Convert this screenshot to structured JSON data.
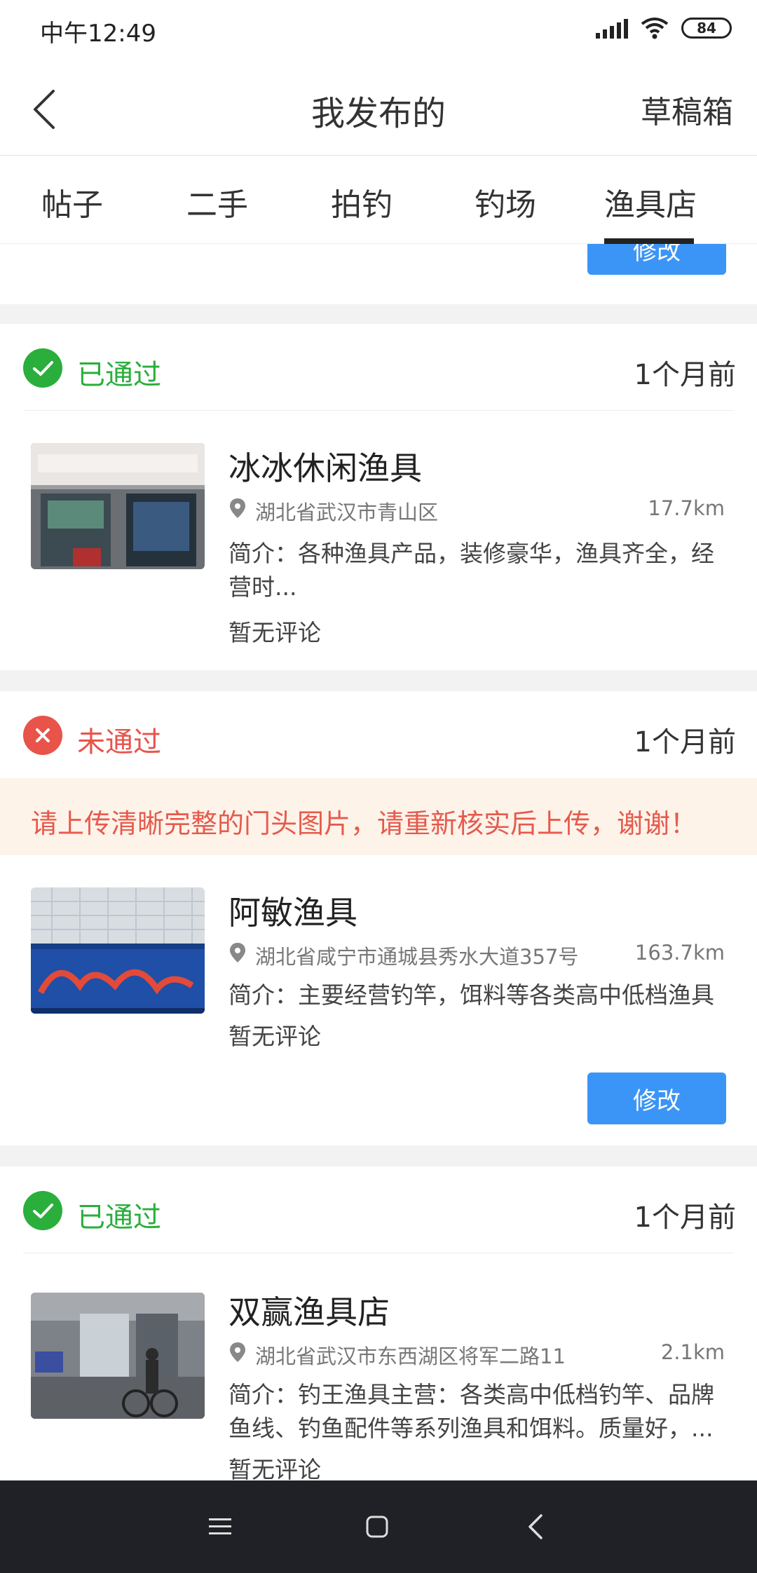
{
  "status_bar": {
    "time": "中午12:49",
    "battery": "84"
  },
  "header": {
    "title": "我发布的",
    "drafts_label": "草稿箱"
  },
  "tabs": [
    {
      "label": "帖子"
    },
    {
      "label": "二手"
    },
    {
      "label": "拍钓"
    },
    {
      "label": "钓场"
    },
    {
      "label": "渔具店",
      "active": true
    }
  ],
  "top_partial": {
    "edit_label": "修改"
  },
  "posts": [
    {
      "status": "已通过",
      "time": "1个月前",
      "name": "冰冰休闲渔具",
      "address": "湖北省武汉市青山区",
      "distance": "17.7km",
      "intro_line1": "简介：各种渔具产品，装修豪华，渔具齐全，经",
      "intro_line2": "营时...",
      "rating": "暂无评论"
    },
    {
      "status": "未通过",
      "time": "1个月前",
      "notice": "请上传清晰完整的门头图片，请重新核实后上传，谢谢！",
      "name": "阿敏渔具",
      "address": "湖北省咸宁市通城县秀水大道357号",
      "distance": "163.7km",
      "intro_line1": "简介：主要经营钓竿，饵料等各类高中低档渔具",
      "rating": "暂无评论",
      "edit_label": "修改"
    },
    {
      "status": "已通过",
      "time": "1个月前",
      "name": "双赢渔具店",
      "address": "湖北省武汉市东西湖区将军二路11",
      "distance": "2.1km",
      "intro_line1": "简介：钓王渔具主营：各类高中低档钓竿、品牌",
      "intro_line2": "鱼线、钓鱼配件等系列渔具和饵料。质量好，...",
      "rating": "暂无评论"
    }
  ],
  "colors": {
    "approved": "#2aae3c",
    "rejected": "#e8534a",
    "accent": "#3b95f6"
  }
}
